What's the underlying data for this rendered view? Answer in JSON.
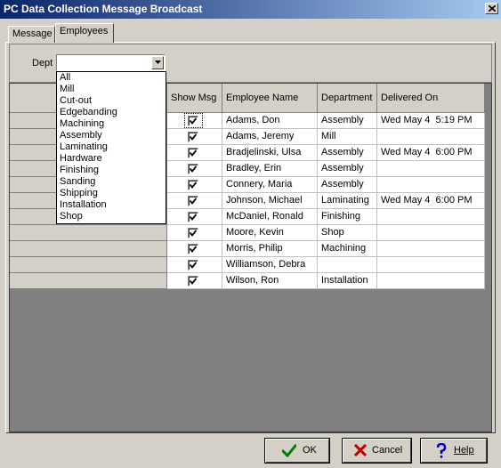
{
  "window": {
    "title": "PC Data Collection Message Broadcast"
  },
  "tabs": [
    {
      "label": "Message"
    },
    {
      "label": "Employees"
    }
  ],
  "dept": {
    "label": "Dept",
    "value": ""
  },
  "dropdown": {
    "options": [
      "All",
      "Mill",
      "Cut-out",
      "Edgebanding",
      "Machining",
      "Assembly",
      "Laminating",
      "Hardware",
      "Finishing",
      "Sanding",
      "Shipping",
      "Installation",
      "Shop"
    ]
  },
  "grid": {
    "columns": [
      "Show Msg",
      "Employee Name",
      "Department",
      "Delivered On"
    ],
    "rows": [
      {
        "checked": true,
        "name": "Adams, Don",
        "department": "Assembly",
        "delivered": "Wed May 4  5:19 PM"
      },
      {
        "checked": true,
        "name": "Adams, Jeremy",
        "department": "Mill",
        "delivered": ""
      },
      {
        "checked": true,
        "name": "Bradjelinski, Ulsa",
        "department": "Assembly",
        "delivered": "Wed May 4  6:00 PM"
      },
      {
        "checked": true,
        "name": "Bradley, Erin",
        "department": "Assembly",
        "delivered": ""
      },
      {
        "checked": true,
        "name": "Connery, Maria",
        "department": "Assembly",
        "delivered": ""
      },
      {
        "checked": true,
        "name": "Johnson, Michael",
        "department": "Laminating",
        "delivered": "Wed May 4  6:00 PM"
      },
      {
        "checked": true,
        "name": "McDaniel, Ronald",
        "department": "Finishing",
        "delivered": ""
      },
      {
        "checked": true,
        "name": "Moore, Kevin",
        "department": "Shop",
        "delivered": ""
      },
      {
        "checked": true,
        "name": "Morris, Philip",
        "department": "Machining",
        "delivered": ""
      },
      {
        "checked": true,
        "name": "Williamson, Debra",
        "department": "",
        "delivered": ""
      },
      {
        "checked": true,
        "name": "Wilson, Ron",
        "department": "Installation",
        "delivered": ""
      }
    ]
  },
  "buttons": {
    "ok": "OK",
    "cancel": "Cancel",
    "help": "Help"
  },
  "icons": {
    "ok": "checkmark-icon",
    "cancel": "x-icon",
    "help": "question-icon",
    "close": "close-icon",
    "dropdown": "chevron-down-icon"
  },
  "colors": {
    "title_start": "#0a246a",
    "title_end": "#a6caf0",
    "ok_icon": "#008000",
    "cancel_icon": "#c00000",
    "help_icon": "#0000c0"
  }
}
